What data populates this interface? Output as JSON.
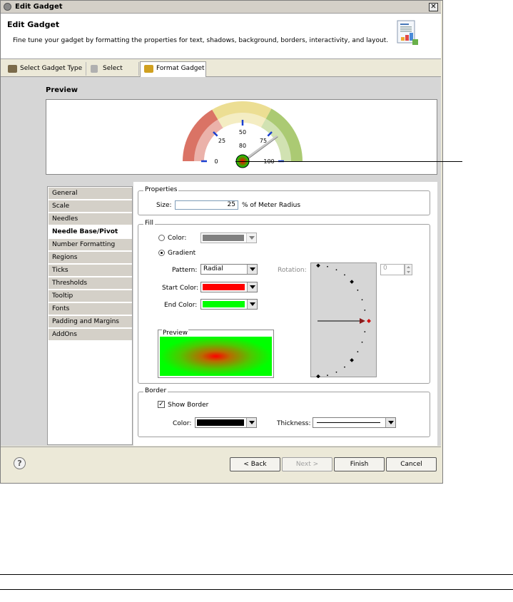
{
  "window": {
    "title": "Edit Gadget"
  },
  "header": {
    "title": "Edit Gadget",
    "description": "Fine tune your gadget by formatting the properties for text, shadows, background, borders, interactivity, and layout."
  },
  "tabs": [
    {
      "label": "Select Gadget Type"
    },
    {
      "label": "Select Data"
    },
    {
      "label": "Format Gadget",
      "active": true
    }
  ],
  "preview": {
    "label": "Preview",
    "gauge": {
      "min": 0,
      "max": 100,
      "value": 80,
      "tick_labels": [
        "0",
        "25",
        "50",
        "75",
        "100"
      ],
      "value_label": "80",
      "regions": [
        {
          "from": 0,
          "to": 33,
          "color": "#d45a4a"
        },
        {
          "from": 33,
          "to": 66,
          "color": "#e9d880"
        },
        {
          "from": 66,
          "to": 100,
          "color": "#9cc15a"
        }
      ]
    }
  },
  "nav": {
    "items": [
      "General",
      "Scale",
      "Needles",
      "Needle Base/Pivot",
      "Number Formatting",
      "Regions",
      "Ticks",
      "Thresholds",
      "Tooltip",
      "Fonts",
      "Padding and Margins",
      "AddOns"
    ],
    "selected": "Needle Base/Pivot"
  },
  "properties": {
    "legend": "Properties",
    "size_label": "Size:",
    "size_value": "25",
    "size_unit": "% of Meter Radius"
  },
  "fill": {
    "legend": "Fill",
    "color_radio_label": "Color:",
    "color_swatch": "#808080",
    "gradient_radio_label": "Gradient",
    "pattern_label": "Pattern:",
    "pattern_value": "Radial",
    "start_color_label": "Start Color:",
    "start_color": "#ff0000",
    "end_color_label": "End Color:",
    "end_color": "#00ff00",
    "rotation_label": "Rotation:",
    "rotation_value": "0",
    "preview_label": "Preview"
  },
  "border": {
    "legend": "Border",
    "show_border_label": "Show Border",
    "show_border_checked": true,
    "color_label": "Color:",
    "color": "#000000",
    "thickness_label": "Thickness:"
  },
  "buttons": {
    "back": "< Back",
    "next": "Next >",
    "finish": "Finish",
    "cancel": "Cancel",
    "help": "?"
  }
}
